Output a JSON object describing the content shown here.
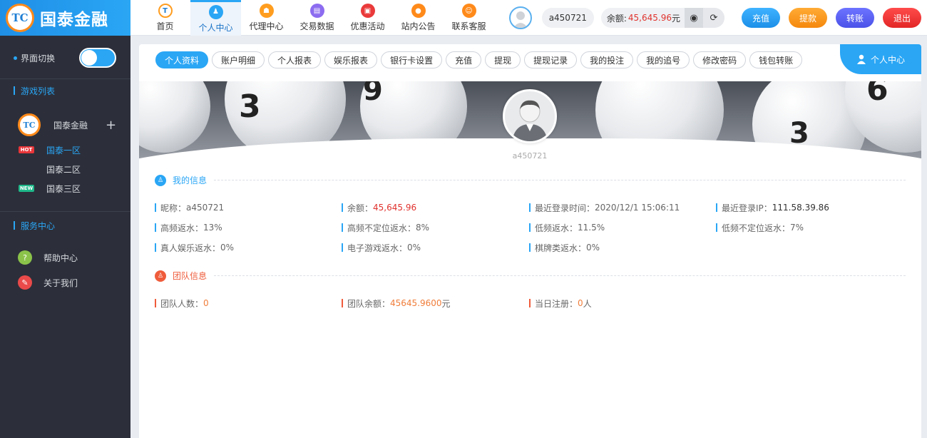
{
  "brand": {
    "name": "国泰金融",
    "mark": "TC"
  },
  "nav": [
    {
      "label": "首页",
      "icon": "home-icon",
      "color": "#ff9d1f",
      "glyph": "T"
    },
    {
      "label": "个人中心",
      "icon": "person-icon",
      "color": "#2aa6f5",
      "glyph": "♟"
    },
    {
      "label": "代理中心",
      "icon": "agent-icon",
      "color": "#ff9d1f",
      "glyph": "☗"
    },
    {
      "label": "交易数据",
      "icon": "data-icon",
      "color": "#8c6cf0",
      "glyph": "▤"
    },
    {
      "label": "优惠活动",
      "icon": "gift-icon",
      "color": "#ea3a3a",
      "glyph": "▣"
    },
    {
      "label": "站内公告",
      "icon": "notice-icon",
      "color": "#ff8a1a",
      "glyph": "●"
    },
    {
      "label": "联系客服",
      "icon": "support-icon",
      "color": "#ff8a1a",
      "glyph": "☺"
    }
  ],
  "user": {
    "username": "a450721"
  },
  "balance": {
    "label": "余额:",
    "amount": "45,645.96",
    "unit": "元"
  },
  "actions": {
    "recharge": "充值",
    "withdraw": "提款",
    "transfer": "转账",
    "logout": "退出"
  },
  "sidebar": {
    "theme_switch": "界面切换",
    "games_title": "游戏列表",
    "platform": "国泰金融",
    "zones": [
      {
        "label": "国泰一区",
        "badge": "HOT"
      },
      {
        "label": "国泰二区",
        "badge": ""
      },
      {
        "label": "国泰三区",
        "badge": "NEW"
      }
    ],
    "service_title": "服务中心",
    "help": "帮助中心",
    "about": "关于我们"
  },
  "tabs": [
    "个人资料",
    "账户明细",
    "个人报表",
    "娱乐报表",
    "银行卡设置",
    "充值",
    "提现",
    "提现记录",
    "我的投注",
    "我的追号",
    "修改密码",
    "钱包转账"
  ],
  "corner_tag": "个人中心",
  "profile": {
    "name": "a450721"
  },
  "my_info": {
    "title": "我的信息",
    "rows": [
      [
        {
          "label": "昵称：",
          "value": "a450721"
        },
        {
          "label": "余额：",
          "value": "45,645.96"
        },
        {
          "label": "最近登录时间：",
          "value": "2020/12/1 15:06:11"
        },
        {
          "label": "最近登录IP：",
          "value": "111.58.39.86"
        }
      ],
      [
        {
          "label": "高频返水：",
          "value": "13%"
        },
        {
          "label": "高频不定位返水：",
          "value": "8%"
        },
        {
          "label": "低频返水：",
          "value": "11.5%"
        },
        {
          "label": "低频不定位返水：",
          "value": "7%"
        }
      ],
      [
        {
          "label": "真人娱乐返水：",
          "value": "0%"
        },
        {
          "label": "电子游戏返水：",
          "value": "0%"
        },
        {
          "label": "棋牌类返水：",
          "value": "0%"
        }
      ]
    ]
  },
  "team_info": {
    "title": "团队信息",
    "members_label": "团队人数：",
    "members_value": "0",
    "balance_label": "团队余额：",
    "balance_value": "45645.9600",
    "balance_unit": "元",
    "today_label": "当日注册：",
    "today_value": "0",
    "today_unit": "人"
  },
  "banner_balls": [
    "3",
    "9",
    "3",
    "6"
  ],
  "colors": {
    "accent": "#2aa6f5",
    "red": "#e0322e",
    "orange": "#f07d3a",
    "sidebar": "#2c2f3a"
  }
}
